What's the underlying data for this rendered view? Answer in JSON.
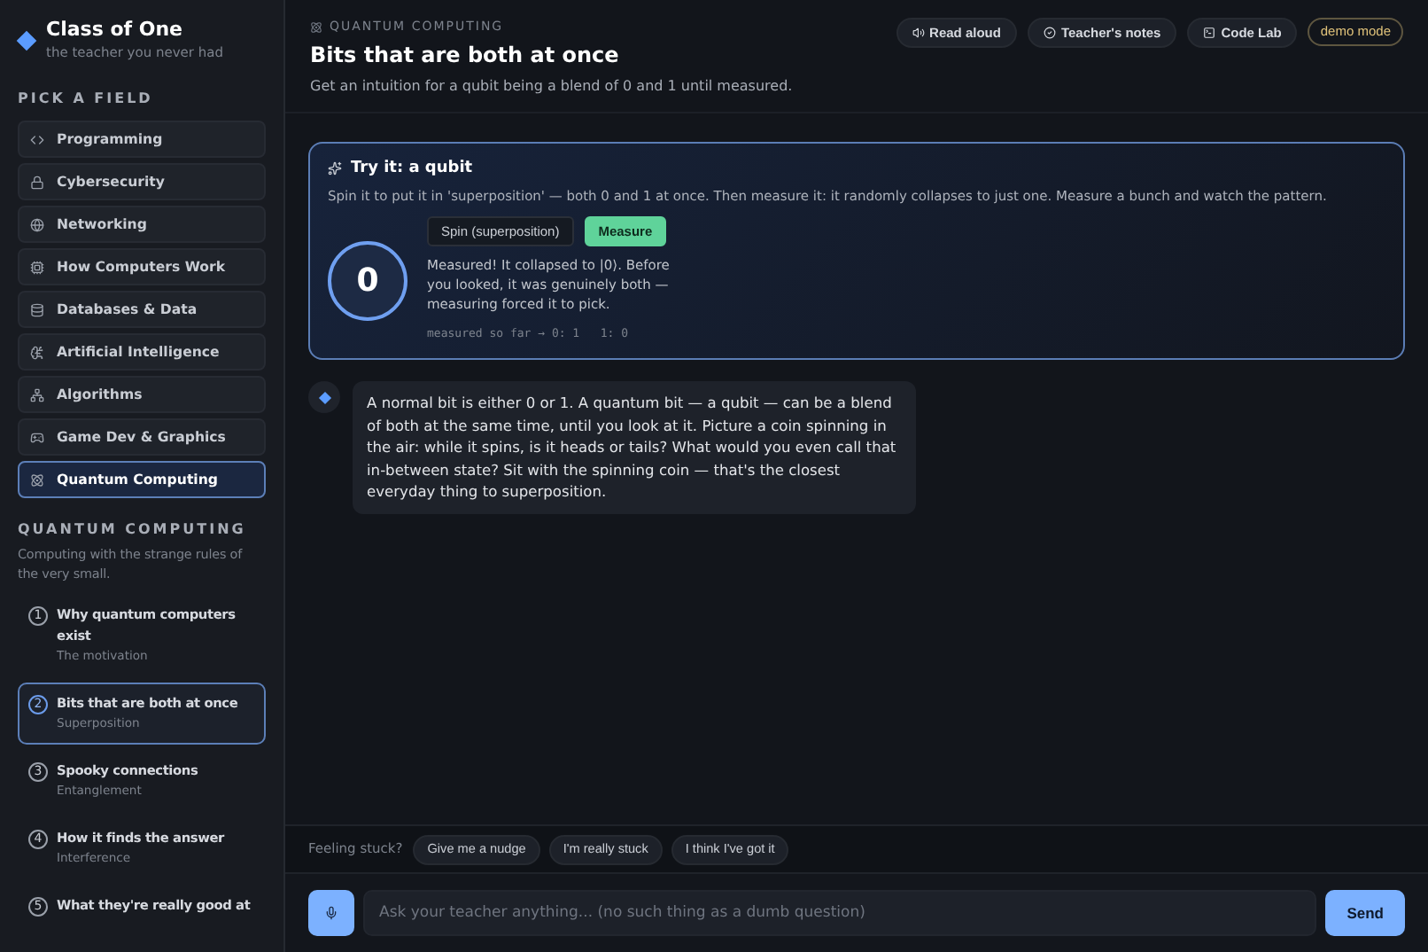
{
  "brand": {
    "title": "Class of One",
    "tagline": "the teacher you never had"
  },
  "fields_heading": "PICK A FIELD",
  "fields": [
    {
      "label": "Programming",
      "selected": false
    },
    {
      "label": "Cybersecurity",
      "selected": false
    },
    {
      "label": "Networking",
      "selected": false
    },
    {
      "label": "How Computers Work",
      "selected": false
    },
    {
      "label": "Databases & Data",
      "selected": false
    },
    {
      "label": "Artificial Intelligence",
      "selected": false
    },
    {
      "label": "Algorithms",
      "selected": false
    },
    {
      "label": "Game Dev & Graphics",
      "selected": false
    },
    {
      "label": "Quantum Computing",
      "selected": true
    }
  ],
  "course": {
    "title": "QUANTUM COMPUTING",
    "description": "Computing with the strange rules of the very small."
  },
  "lessons": [
    {
      "number": "1",
      "title": "Why quantum computers exist",
      "subtitle": "The motivation",
      "selected": false
    },
    {
      "number": "2",
      "title": "Bits that are both at once",
      "subtitle": "Superposition",
      "selected": true
    },
    {
      "number": "3",
      "title": "Spooky connections",
      "subtitle": "Entanglement",
      "selected": false
    },
    {
      "number": "4",
      "title": "How it finds the answer",
      "subtitle": "Interference",
      "selected": false
    },
    {
      "number": "5",
      "title": "What they're really good at",
      "selected": false
    }
  ],
  "header": {
    "breadcrumb": "QUANTUM COMPUTING",
    "title": "Bits that are both at once",
    "subtitle": "Get an intuition for a qubit being a blend of 0 and 1 until measured.",
    "actions": [
      {
        "label": "Read aloud",
        "kind": "speaker"
      },
      {
        "label": "Teacher's notes",
        "kind": "notes"
      },
      {
        "label": "Code Lab",
        "kind": "code"
      }
    ],
    "mode_badge": "demo mode"
  },
  "activity": {
    "title": "Try it: a qubit",
    "instructions": "Spin it to put it in 'superposition' — both 0 and 1 at once. Then measure it: it randomly collapses to just one. Measure a bunch and watch the pattern.",
    "qubit_value": "0",
    "buttons": [
      {
        "label": "Spin (superposition)",
        "selected": false
      },
      {
        "label": "Measure",
        "selected": true
      }
    ],
    "result": "Measured! It collapsed to |0⟩. Before you looked, it was genuinely both — measuring forced it to pick.",
    "tally": "measured so far → 0: 1   1: 0"
  },
  "messages": [
    {
      "text": "A normal bit is either 0 or 1. A quantum bit — a qubit — can be a blend of both at the same time, until you look at it. Picture a coin spinning in the air: while it spins, is it heads or tails? What would you even call that in-between state? Sit with the spinning coin — that's the closest everyday thing to superposition."
    }
  ],
  "help": {
    "label": "Feeling stuck?",
    "options": [
      "Give me a nudge",
      "I'm really stuck",
      "I think I've got it"
    ]
  },
  "composer": {
    "placeholder": "Ask your teacher anything... (no such thing as a dumb question)",
    "send": "Send"
  }
}
